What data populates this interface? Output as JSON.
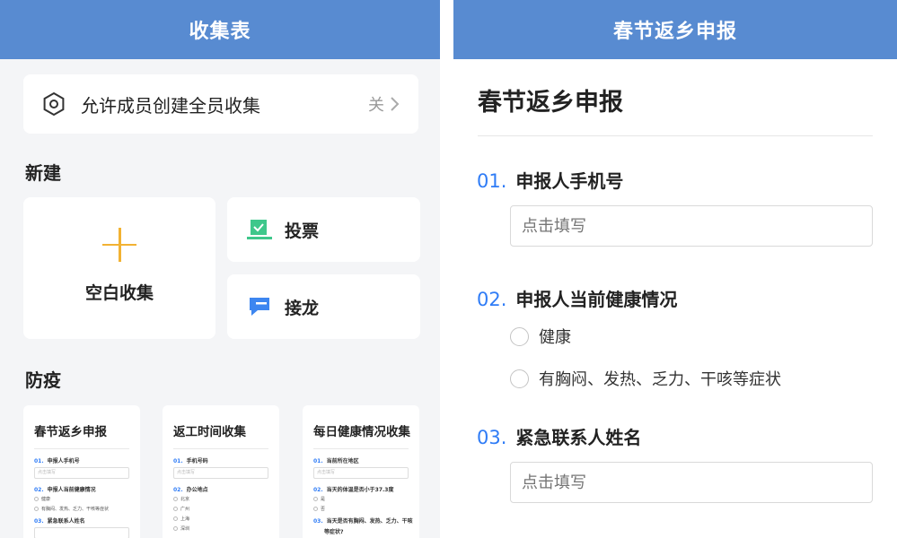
{
  "left": {
    "header_title": "收集表",
    "allow_row": {
      "label": "允许成员创建全员收集",
      "value": "关"
    },
    "new_section": {
      "title": "新建",
      "blank_label": "空白收集",
      "vote_label": "投票",
      "relay_label": "接龙"
    },
    "epidemic_section": {
      "title": "防疫",
      "templates": [
        {
          "title": "春节返乡申报",
          "q1": {
            "num": "01.",
            "label": "申报人手机号",
            "placeholder": "点击填写"
          },
          "q2": {
            "num": "02.",
            "label": "申报人当前健康情况",
            "options": [
              "健康",
              "有胸闷、发热、乏力、干咳等症状"
            ]
          },
          "q3": {
            "num": "03.",
            "label": "紧急联系人姓名"
          }
        },
        {
          "title": "返工时间收集",
          "q1": {
            "num": "01.",
            "label": "手机号码",
            "placeholder": "点击填写"
          },
          "q2": {
            "num": "02.",
            "label": "办公地点",
            "options": [
              "北京",
              "广州",
              "上海",
              "深圳"
            ]
          }
        },
        {
          "title": "每日健康情况收集",
          "q1": {
            "num": "01.",
            "label": "当前所在地区",
            "placeholder": "点击填写"
          },
          "q2": {
            "num": "02.",
            "label": "当天的体温是否小于37.3度",
            "options": [
              "是",
              "否"
            ]
          },
          "q3": {
            "num": "03.",
            "label": "当天是否有胸闷、发热、乏力、干咳",
            "label2": "等症状?"
          }
        }
      ]
    }
  },
  "right": {
    "header_title": "春节返乡申报",
    "form_title": "春节返乡申报",
    "questions": [
      {
        "num": "01.",
        "label": "申报人手机号",
        "placeholder": "点击填写"
      },
      {
        "num": "02.",
        "label": "申报人当前健康情况",
        "options": [
          "健康",
          "有胸闷、发热、乏力、干咳等症状"
        ]
      },
      {
        "num": "03.",
        "label": "紧急联系人姓名",
        "placeholder": "点击填写"
      }
    ]
  },
  "colors": {
    "header_bg": "#588bd1",
    "accent_blue": "#2f7cf6",
    "plus_yellow": "#f2b233",
    "vote_green": "#3ec78b",
    "relay_blue": "#3d86f0"
  },
  "icons": {
    "allow": "hexagon-settings-icon",
    "chevron": "chevron-right-icon",
    "blank": "plus-icon",
    "vote": "vote-check-icon",
    "relay": "chat-bubble-icon"
  }
}
